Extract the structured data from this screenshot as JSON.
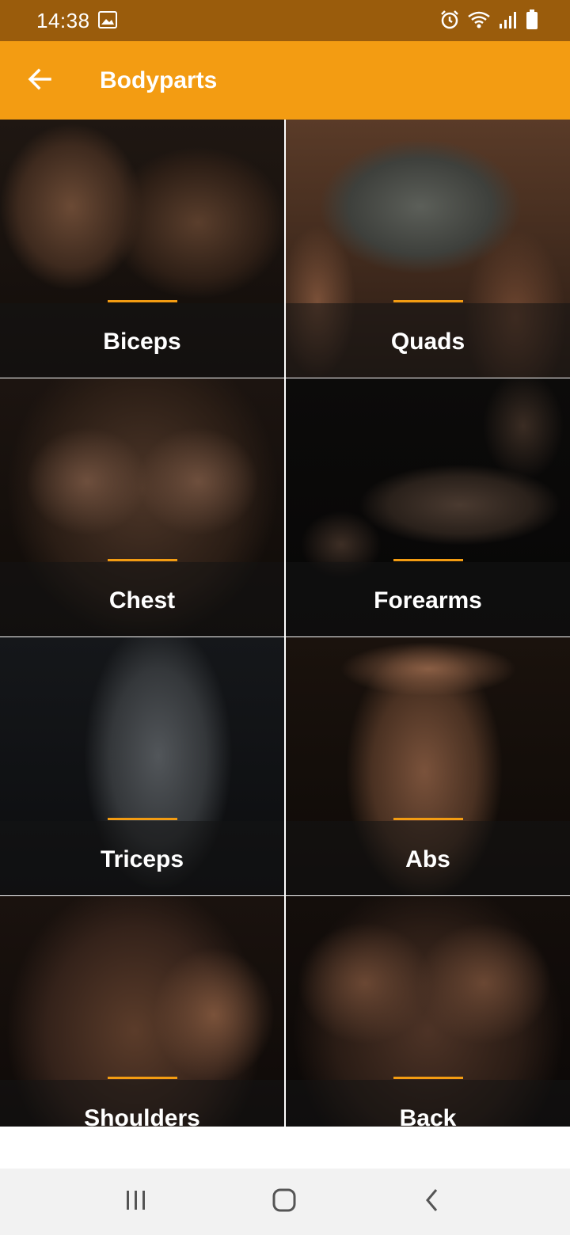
{
  "status_bar": {
    "time": "14:38",
    "icons": [
      "image-icon",
      "alarm-icon",
      "wifi-icon",
      "signal-icon",
      "battery-icon"
    ]
  },
  "app_bar": {
    "title": "Bodyparts",
    "back_icon": "arrow-back-icon"
  },
  "colors": {
    "accent": "#f39c12",
    "status_bar": "#9a5c0c"
  },
  "bodyparts": [
    {
      "label": "Biceps"
    },
    {
      "label": "Quads"
    },
    {
      "label": "Chest"
    },
    {
      "label": "Forearms"
    },
    {
      "label": "Triceps"
    },
    {
      "label": "Abs"
    },
    {
      "label": "Shoulders"
    },
    {
      "label": "Back"
    }
  ],
  "nav_bar": {
    "icons": [
      "recent-apps-icon",
      "home-icon",
      "back-icon"
    ]
  }
}
